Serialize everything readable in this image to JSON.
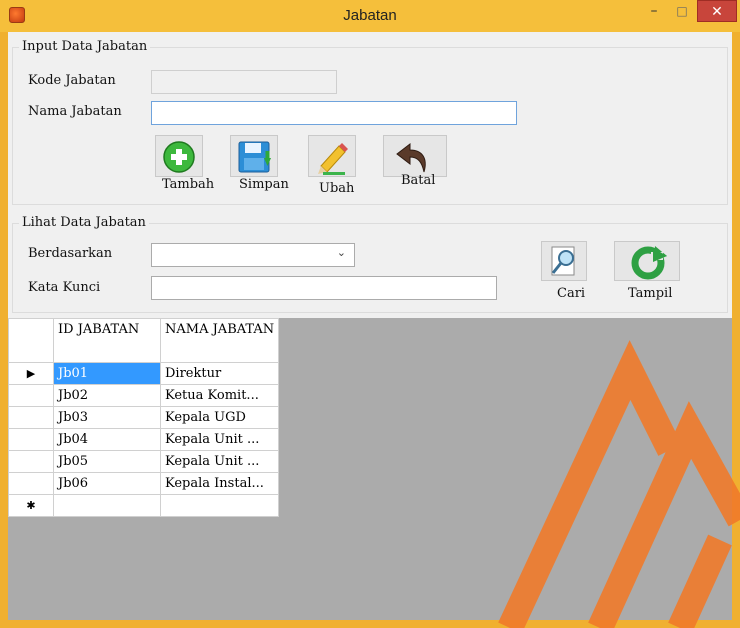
{
  "window": {
    "title": "Jabatan",
    "min": "–",
    "max": "□",
    "close": "✕"
  },
  "input_group": {
    "legend": "Input Data Jabatan",
    "kode_label": "Kode Jabatan",
    "kode_value": "",
    "nama_label": "Nama Jabatan",
    "nama_value": "",
    "buttons": {
      "tambah": "Tambah",
      "simpan": "Simpan",
      "ubah": "Ubah",
      "batal": "Batal"
    }
  },
  "view_group": {
    "legend": "Lihat Data Jabatan",
    "berdasarkan_label": "Berdasarkan",
    "berdasarkan_value": "",
    "kata_kunci_label": "Kata Kunci",
    "kata_kunci_value": "",
    "buttons": {
      "cari": "Cari",
      "tampil": "Tampil"
    }
  },
  "grid": {
    "columns": [
      "ID JABATAN",
      "NAMA JABATAN"
    ],
    "rows": [
      {
        "id": "Jb01",
        "nama": "Direktur"
      },
      {
        "id": "Jb02",
        "nama": "Ketua Komit..."
      },
      {
        "id": "Jb03",
        "nama": "Kepala UGD"
      },
      {
        "id": "Jb04",
        "nama": "Kepala Unit ..."
      },
      {
        "id": "Jb05",
        "nama": "Kepala Unit ..."
      },
      {
        "id": "Jb06",
        "nama": "Kepala Instal..."
      }
    ],
    "current_marker": "▶",
    "new_row_marker": "✱"
  },
  "colors": {
    "title_bar": "#f5bf3b",
    "close": "#c8453b",
    "selection": "#3399ff",
    "grid_bg": "#ababab"
  }
}
